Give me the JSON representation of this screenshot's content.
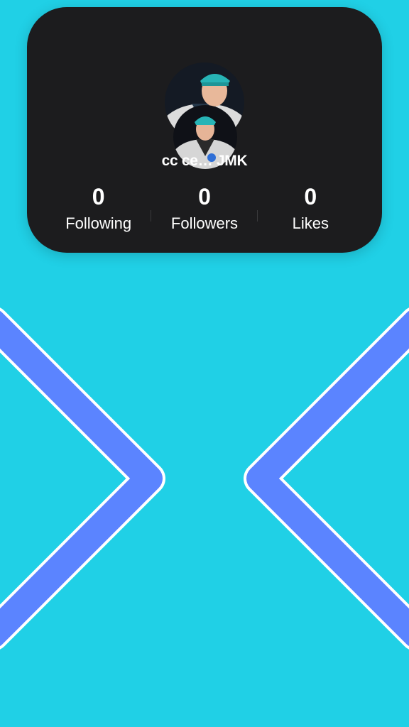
{
  "profile": {
    "username": "cc ce… JMK",
    "avatar_back": "profile-photo",
    "avatar_front": "profile-photo"
  },
  "stats": [
    {
      "count": "0",
      "label": "Following"
    },
    {
      "count": "0",
      "label": "Followers"
    },
    {
      "count": "0",
      "label": "Likes"
    }
  ],
  "navigation": {
    "prev_icon": "chevron-left-icon",
    "next_icon": "chevron-right-icon"
  },
  "colors": {
    "background": "#20d0e6",
    "card": "#1c1c1e",
    "text": "#ffffff",
    "chevron": "#5b84ff",
    "chevron_outline": "#ffffff",
    "cap": "#27b4b6"
  }
}
